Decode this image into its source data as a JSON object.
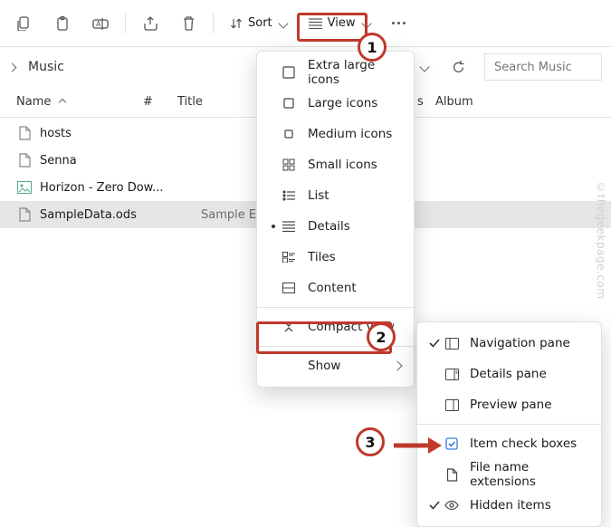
{
  "toolbar": {
    "sort_label": "Sort",
    "view_label": "View"
  },
  "breadcrumb": {
    "current": "Music"
  },
  "search": {
    "placeholder": "Search Music"
  },
  "columns": {
    "name": "Name",
    "num": "#",
    "title": "Title",
    "mid": "s",
    "album": "Album"
  },
  "files": [
    {
      "name": "hosts",
      "title": "",
      "icon": "doc"
    },
    {
      "name": "Senna",
      "title": "",
      "icon": "doc"
    },
    {
      "name": "Horizon - Zero Dow...",
      "title": "",
      "icon": "img"
    },
    {
      "name": "SampleData.ods",
      "title": "Sample Excel",
      "icon": "doc",
      "selected": true
    }
  ],
  "viewMenu": [
    {
      "label": "Extra large icons",
      "icon": "xl"
    },
    {
      "label": "Large icons",
      "icon": "lg"
    },
    {
      "label": "Medium icons",
      "icon": "md"
    },
    {
      "label": "Small icons",
      "icon": "sm"
    },
    {
      "label": "List",
      "icon": "list"
    },
    {
      "label": "Details",
      "icon": "details",
      "bullet": true
    },
    {
      "label": "Tiles",
      "icon": "tiles"
    },
    {
      "label": "Content",
      "icon": "content"
    }
  ],
  "compact_label": "Compact view",
  "show_label": "Show",
  "showMenu": [
    {
      "label": "Navigation pane",
      "icon": "nav",
      "checked": true
    },
    {
      "label": "Details pane",
      "icon": "details-pane"
    },
    {
      "label": "Preview pane",
      "icon": "preview"
    }
  ],
  "showMenu2": [
    {
      "label": "Item check boxes",
      "icon": "checkbox"
    },
    {
      "label": "File name extensions",
      "icon": "ext"
    },
    {
      "label": "Hidden items",
      "icon": "hidden",
      "checked": true
    }
  ],
  "watermark": "©thegeekpage.com"
}
